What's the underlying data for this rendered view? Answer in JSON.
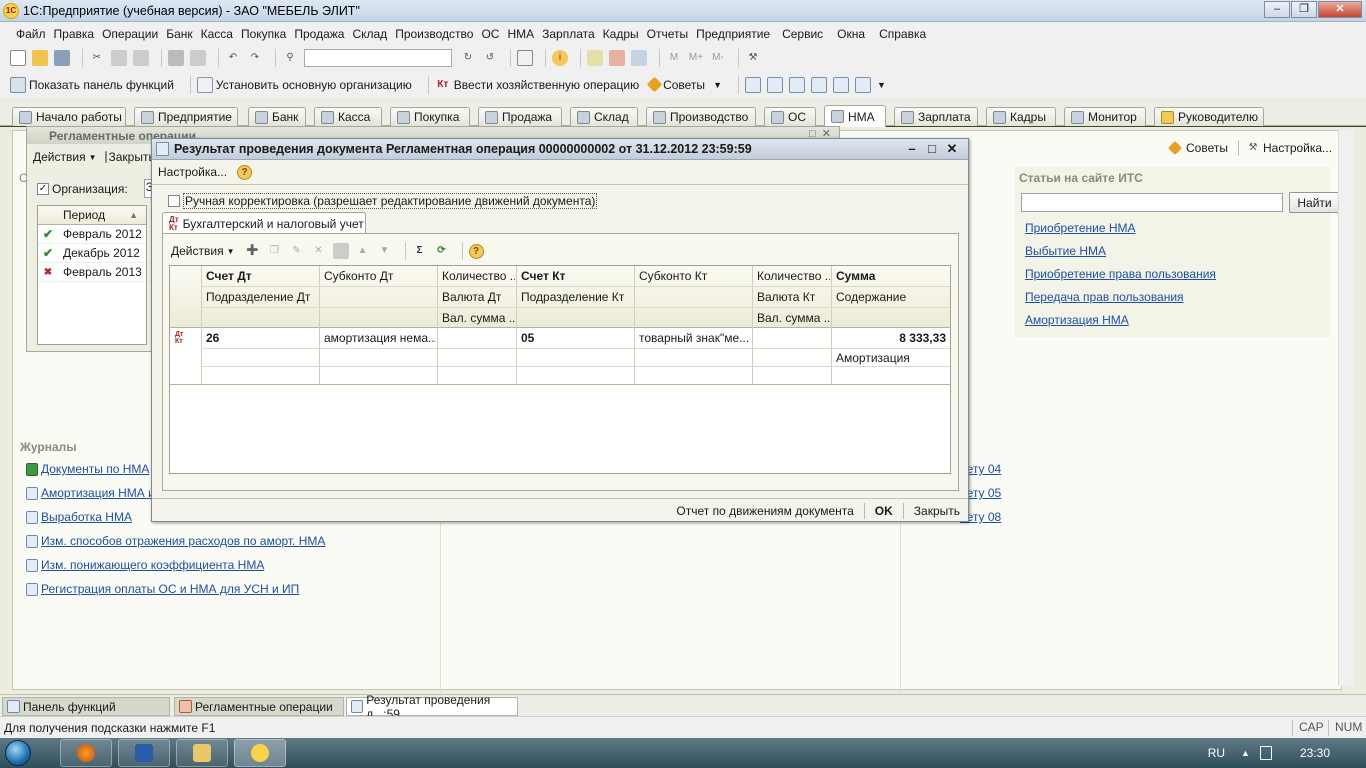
{
  "window": {
    "title": "1С:Предприятие (учебная версия) - ЗАО \"МЕБЕЛЬ ЭЛИТ\"",
    "app_logo": "1C"
  },
  "menubar": [
    "Файл",
    "Правка",
    "Операции",
    "Банк",
    "Касса",
    "Покупка",
    "Продажа",
    "Склад",
    "Производство",
    "ОС",
    "НМА",
    "Зарплата",
    "Кадры",
    "Отчеты",
    "Предприятие",
    "Сервис",
    "Окна",
    "Справка"
  ],
  "toolbar2": {
    "show_panel": "Показать панель функций",
    "set_org": "Установить основную организацию",
    "enter_op": "Ввести хозяйственную операцию",
    "tips": "Советы"
  },
  "tabs": [
    "Начало работы",
    "Предприятие",
    "Банк",
    "Касса",
    "Покупка",
    "Продажа",
    "Склад",
    "Производство",
    "ОС",
    "НМА",
    "Зарплата",
    "Кадры",
    "Монитор",
    "Руководителю"
  ],
  "active_tab": "НМА",
  "topright": {
    "tips": "Советы",
    "settings": "Настройка..."
  },
  "its": {
    "header": "Статьи на сайте ИТС",
    "find_button": "Найти",
    "links": [
      "Приобретение НМА",
      "Выбытие НМА ",
      "Приобретение права пользования",
      "Передача прав пользования",
      "Амортизация НМА"
    ]
  },
  "journals": {
    "header": "Журналы",
    "items": [
      "Документы по НМА",
      "Амортизация НМА и с",
      "Выработка НМА",
      "Изм. способов отражения расходов по аморт. НМА",
      "Изм. понижающего коэффициента НМА",
      "Регистрация оплаты ОС и НМА для УСН и ИП"
    ],
    "right_items": [
      "нету 04",
      "нету 05",
      "нету 08"
    ]
  },
  "regl": {
    "title": "Регламентные операции",
    "actions": "Действия",
    "close": "Закрыть",
    "org_label": "Организация:",
    "org_value": "ЗА",
    "period_header": "Период",
    "rows": [
      "Февраль 2012",
      "Декабрь 2012",
      "Февраль 2013"
    ],
    "side_letter": "С"
  },
  "dialog": {
    "title": "Результат проведения документа Регламентная операция 00000000002 от 31.12.2012 23:59:59",
    "settings": "Настройка...",
    "manual_checkbox": "Ручная корректировка (разрешает редактирование движений документа)",
    "manual_checked": false,
    "subtab": "Бухгалтерский и налоговый учет",
    "actions": "Действия",
    "headers": {
      "r1": [
        "Счет Дт",
        "Субконто Дт",
        "Количество ...",
        "Счет Кт",
        "Субконто Кт",
        "Количество ...",
        "Сумма"
      ],
      "r2": [
        "Подразделение Дт",
        "",
        "Валюта Дт",
        "Подразделение Кт",
        "",
        "Валюта Кт",
        "Содержание"
      ],
      "r3": [
        "",
        "",
        "Вал. сумма ...",
        "",
        "",
        "Вал. сумма ...",
        ""
      ]
    },
    "row": {
      "dt_account": "26",
      "subconto_dt": "амортизация нема...",
      "kt_account": "05",
      "subconto_kt": "товарный знак\"ме...",
      "sum": "8 333,33",
      "content": "Амортизация"
    },
    "bottom": {
      "report": "Отчет по движениям документа",
      "ok": "OK",
      "close": "Закрыть"
    }
  },
  "window_tabs": [
    "Панель функций",
    "Регламентные операции",
    "Результат проведения д...:59"
  ],
  "status": {
    "hint": "Для получения подсказки нажмите F1",
    "cap": "CAP",
    "num": "NUM"
  },
  "taskbar": {
    "lang": "RU",
    "time": "23:30"
  },
  "colors": {
    "link": "#1c50a8",
    "check_green": "#2c8a2c",
    "error_red": "#c02020"
  }
}
